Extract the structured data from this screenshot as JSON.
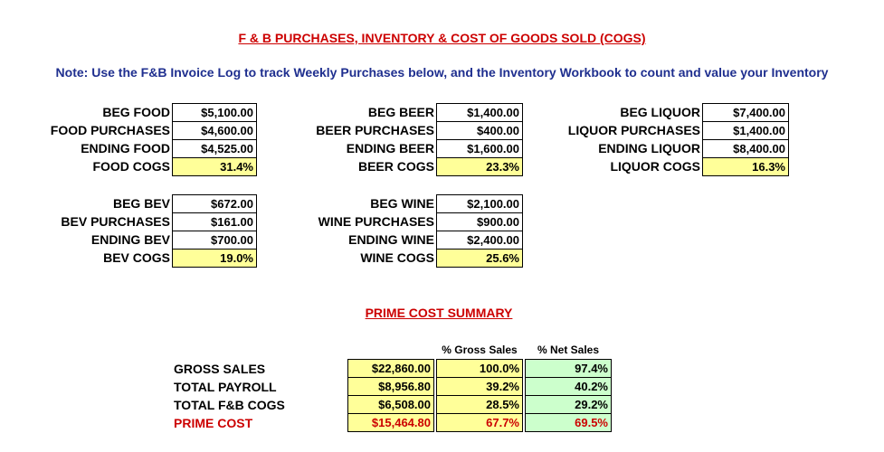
{
  "title": "F & B PURCHASES, INVENTORY & COST OF GOODS SOLD (COGS)",
  "note": "Note: Use the F&B Invoice Log to track Weekly Purchases below, and the Inventory Workbook to count and value your Inventory",
  "food": {
    "labels": [
      "BEG FOOD",
      "FOOD PURCHASES",
      "ENDING  FOOD",
      "FOOD COGS"
    ],
    "values": [
      "$5,100.00",
      "$4,600.00",
      "$4,525.00",
      "31.4%"
    ]
  },
  "beer": {
    "labels": [
      "BEG BEER",
      "BEER PURCHASES",
      "ENDING BEER",
      "BEER COGS"
    ],
    "values": [
      "$1,400.00",
      "$400.00",
      "$1,600.00",
      "23.3%"
    ]
  },
  "liquor": {
    "labels": [
      "BEG LIQUOR",
      "LIQUOR PURCHASES",
      "ENDING LIQUOR",
      "LIQUOR COGS"
    ],
    "values": [
      "$7,400.00",
      "$1,400.00",
      "$8,400.00",
      "16.3%"
    ]
  },
  "bev": {
    "labels": [
      "BEG BEV",
      "BEV PURCHASES",
      "ENDING BEV",
      "BEV COGS"
    ],
    "values": [
      "$672.00",
      "$161.00",
      "$700.00",
      "19.0%"
    ]
  },
  "wine": {
    "labels": [
      "BEG WINE",
      "WINE PURCHASES",
      "ENDING WINE",
      "WINE COGS"
    ],
    "values": [
      "$2,100.00",
      "$900.00",
      "$2,400.00",
      "25.6%"
    ]
  },
  "prime": {
    "title": "PRIME COST SUMMARY ",
    "col_gross": "% Gross Sales",
    "col_net": "% Net Sales",
    "rows": [
      {
        "label": "GROSS SALES",
        "amount": "$22,860.00",
        "gross": "100.0%",
        "net": "97.4%"
      },
      {
        "label": "TOTAL PAYROLL",
        "amount": "$8,956.80",
        "gross": "39.2%",
        "net": "40.2%"
      },
      {
        "label": "TOTAL F&B COGS",
        "amount": "$6,508.00",
        "gross": "28.5%",
        "net": "29.2%"
      },
      {
        "label": "PRIME COST",
        "amount": "$15,464.80",
        "gross": "67.7%",
        "net": "69.5%"
      }
    ]
  },
  "colors": {
    "title_red": "#cc0000",
    "note_blue": "#1f2f8f",
    "cogs_yellow": "#ffff99",
    "net_green": "#ccffcc"
  }
}
